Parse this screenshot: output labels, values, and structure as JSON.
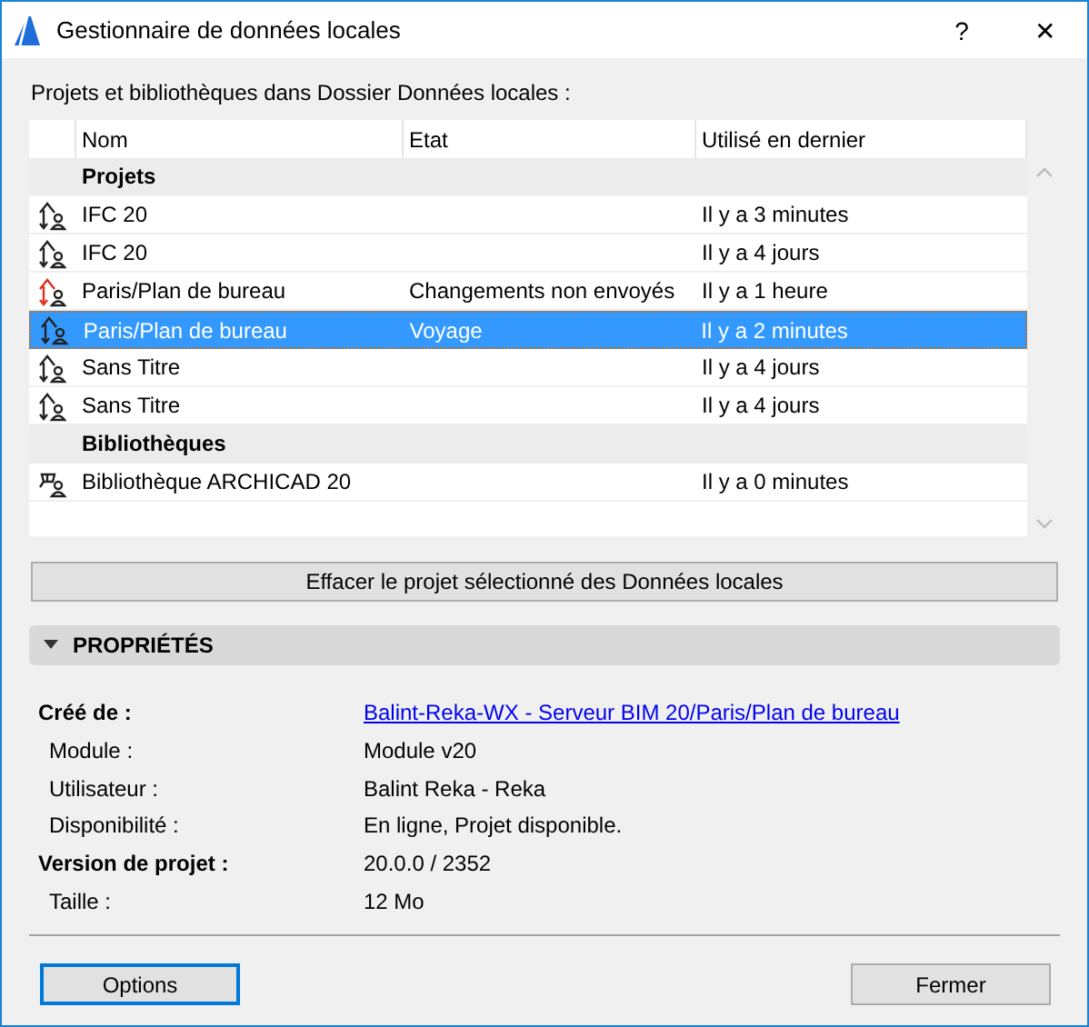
{
  "window": {
    "title": "Gestionnaire de données locales",
    "help": "?",
    "close": "✕"
  },
  "list_label": "Projets et bibliothèques dans Dossier Données locales :",
  "table": {
    "columns": [
      "Nom",
      "Etat",
      "Utilisé en dernier"
    ],
    "rows": [
      {
        "kind": "group",
        "name": "Projets"
      },
      {
        "kind": "project",
        "name": "IFC 20",
        "state": "",
        "last_used": "Il y a 3 minutes",
        "modified": false,
        "selected": false
      },
      {
        "kind": "project",
        "name": "IFC 20",
        "state": "",
        "last_used": "Il y a 4 jours",
        "modified": false,
        "selected": false
      },
      {
        "kind": "project",
        "name": "Paris/Plan de bureau",
        "state": "Changements non envoyés",
        "last_used": "Il y a 1 heure",
        "modified": true,
        "selected": false
      },
      {
        "kind": "project",
        "name": "Paris/Plan de bureau",
        "state": "Voyage",
        "last_used": "Il y a 2 minutes",
        "modified": false,
        "selected": true
      },
      {
        "kind": "project",
        "name": "Sans Titre",
        "state": "",
        "last_used": "Il y a 4 jours",
        "modified": false,
        "selected": false
      },
      {
        "kind": "project",
        "name": "Sans Titre",
        "state": "",
        "last_used": "Il y a 4 jours",
        "modified": false,
        "selected": false
      },
      {
        "kind": "group",
        "name": "Bibliothèques"
      },
      {
        "kind": "library",
        "name": "Bibliothèque ARCHICAD 20",
        "state": "",
        "last_used": "Il y a 0 minutes",
        "selected": false
      }
    ]
  },
  "delete_button": "Effacer le projet sélectionné des Données locales",
  "properties": {
    "title": "PROPRIÉTÉS",
    "expanded": true,
    "items": [
      {
        "kind": "heading",
        "label": "Créé de :",
        "value": "Balint-Reka-WX - Serveur BIM 20/Paris/Plan de bureau",
        "link": true
      },
      {
        "kind": "detail",
        "label": "Module :",
        "value": "Module v20",
        "link": false
      },
      {
        "kind": "detail",
        "label": "Utilisateur :",
        "value": "Balint Reka - Reka",
        "link": false
      },
      {
        "kind": "detail",
        "label": "Disponibilité :",
        "value": "En ligne, Projet disponible.",
        "link": false
      },
      {
        "kind": "heading",
        "label": "Version de projet :",
        "value": "20.0.0 / 2352",
        "link": false
      },
      {
        "kind": "detail",
        "label": "Taille :",
        "value": "12 Mo",
        "link": false
      }
    ]
  },
  "buttons": [
    {
      "label": "Options",
      "default": true
    },
    {
      "label": "Fermer",
      "default": false
    }
  ]
}
